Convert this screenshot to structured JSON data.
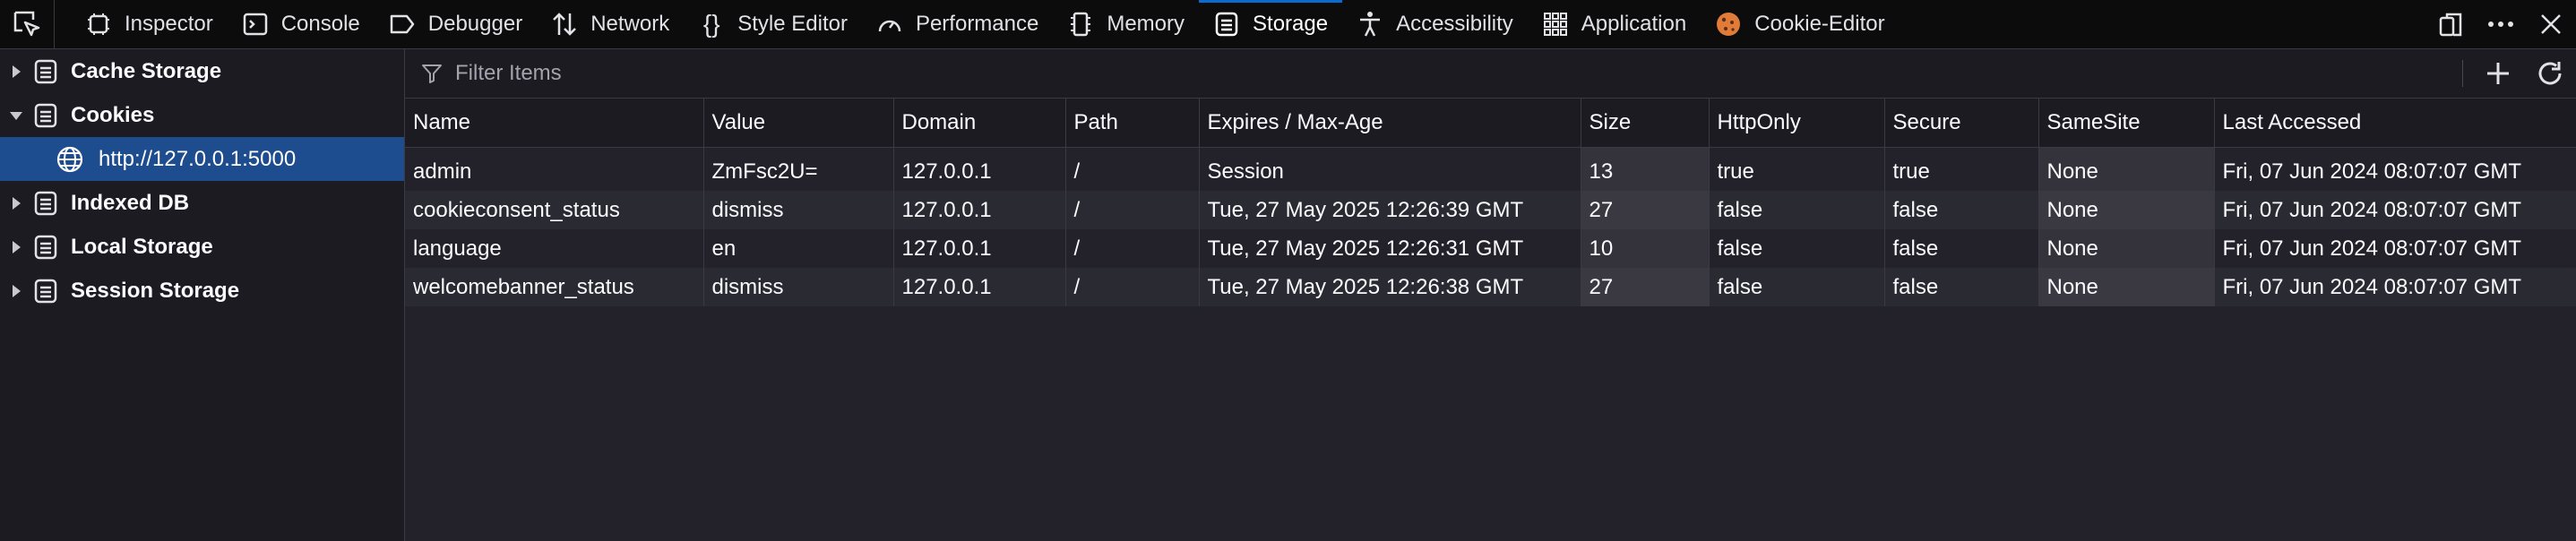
{
  "toolbar": {
    "tabs": [
      {
        "label": "Inspector",
        "icon": "inspector-icon"
      },
      {
        "label": "Console",
        "icon": "console-icon"
      },
      {
        "label": "Debugger",
        "icon": "debugger-icon"
      },
      {
        "label": "Network",
        "icon": "network-icon"
      },
      {
        "label": "Style Editor",
        "icon": "style-editor-icon"
      },
      {
        "label": "Performance",
        "icon": "performance-icon"
      },
      {
        "label": "Memory",
        "icon": "memory-icon"
      },
      {
        "label": "Storage",
        "icon": "storage-icon",
        "active": true
      },
      {
        "label": "Accessibility",
        "icon": "accessibility-icon"
      },
      {
        "label": "Application",
        "icon": "application-icon"
      },
      {
        "label": "Cookie-Editor",
        "icon": "cookie-icon"
      }
    ]
  },
  "sidebar": {
    "items": [
      {
        "label": "Cache Storage",
        "expanded": false
      },
      {
        "label": "Cookies",
        "expanded": true,
        "children": [
          {
            "label": "http://127.0.0.1:5000",
            "selected": true
          }
        ]
      },
      {
        "label": "Indexed DB",
        "expanded": false
      },
      {
        "label": "Local Storage",
        "expanded": false
      },
      {
        "label": "Session Storage",
        "expanded": false
      }
    ]
  },
  "filter": {
    "placeholder": "Filter Items",
    "value": ""
  },
  "table": {
    "headers": [
      "Name",
      "Value",
      "Domain",
      "Path",
      "Expires / Max-Age",
      "Size",
      "HttpOnly",
      "Secure",
      "SameSite",
      "Last Accessed"
    ],
    "rows": [
      [
        "admin",
        "ZmFsc2U=",
        "127.0.0.1",
        "/",
        "Session",
        "13",
        "true",
        "true",
        "None",
        "Fri, 07 Jun 2024 08:07:07 GMT"
      ],
      [
        "cookieconsent_status",
        "dismiss",
        "127.0.0.1",
        "/",
        "Tue, 27 May 2025 12:26:39 GMT",
        "27",
        "false",
        "false",
        "None",
        "Fri, 07 Jun 2024 08:07:07 GMT"
      ],
      [
        "language",
        "en",
        "127.0.0.1",
        "/",
        "Tue, 27 May 2025 12:26:31 GMT",
        "10",
        "false",
        "false",
        "None",
        "Fri, 07 Jun 2024 08:07:07 GMT"
      ],
      [
        "welcomebanner_status",
        "dismiss",
        "127.0.0.1",
        "/",
        "Tue, 27 May 2025 12:26:38 GMT",
        "27",
        "false",
        "false",
        "None",
        "Fri, 07 Jun 2024 08:07:07 GMT"
      ]
    ]
  },
  "colors": {
    "accent": "#0b6bd3",
    "selected_row": "#1d4c8f",
    "cookie_editor": "#e07b39"
  }
}
